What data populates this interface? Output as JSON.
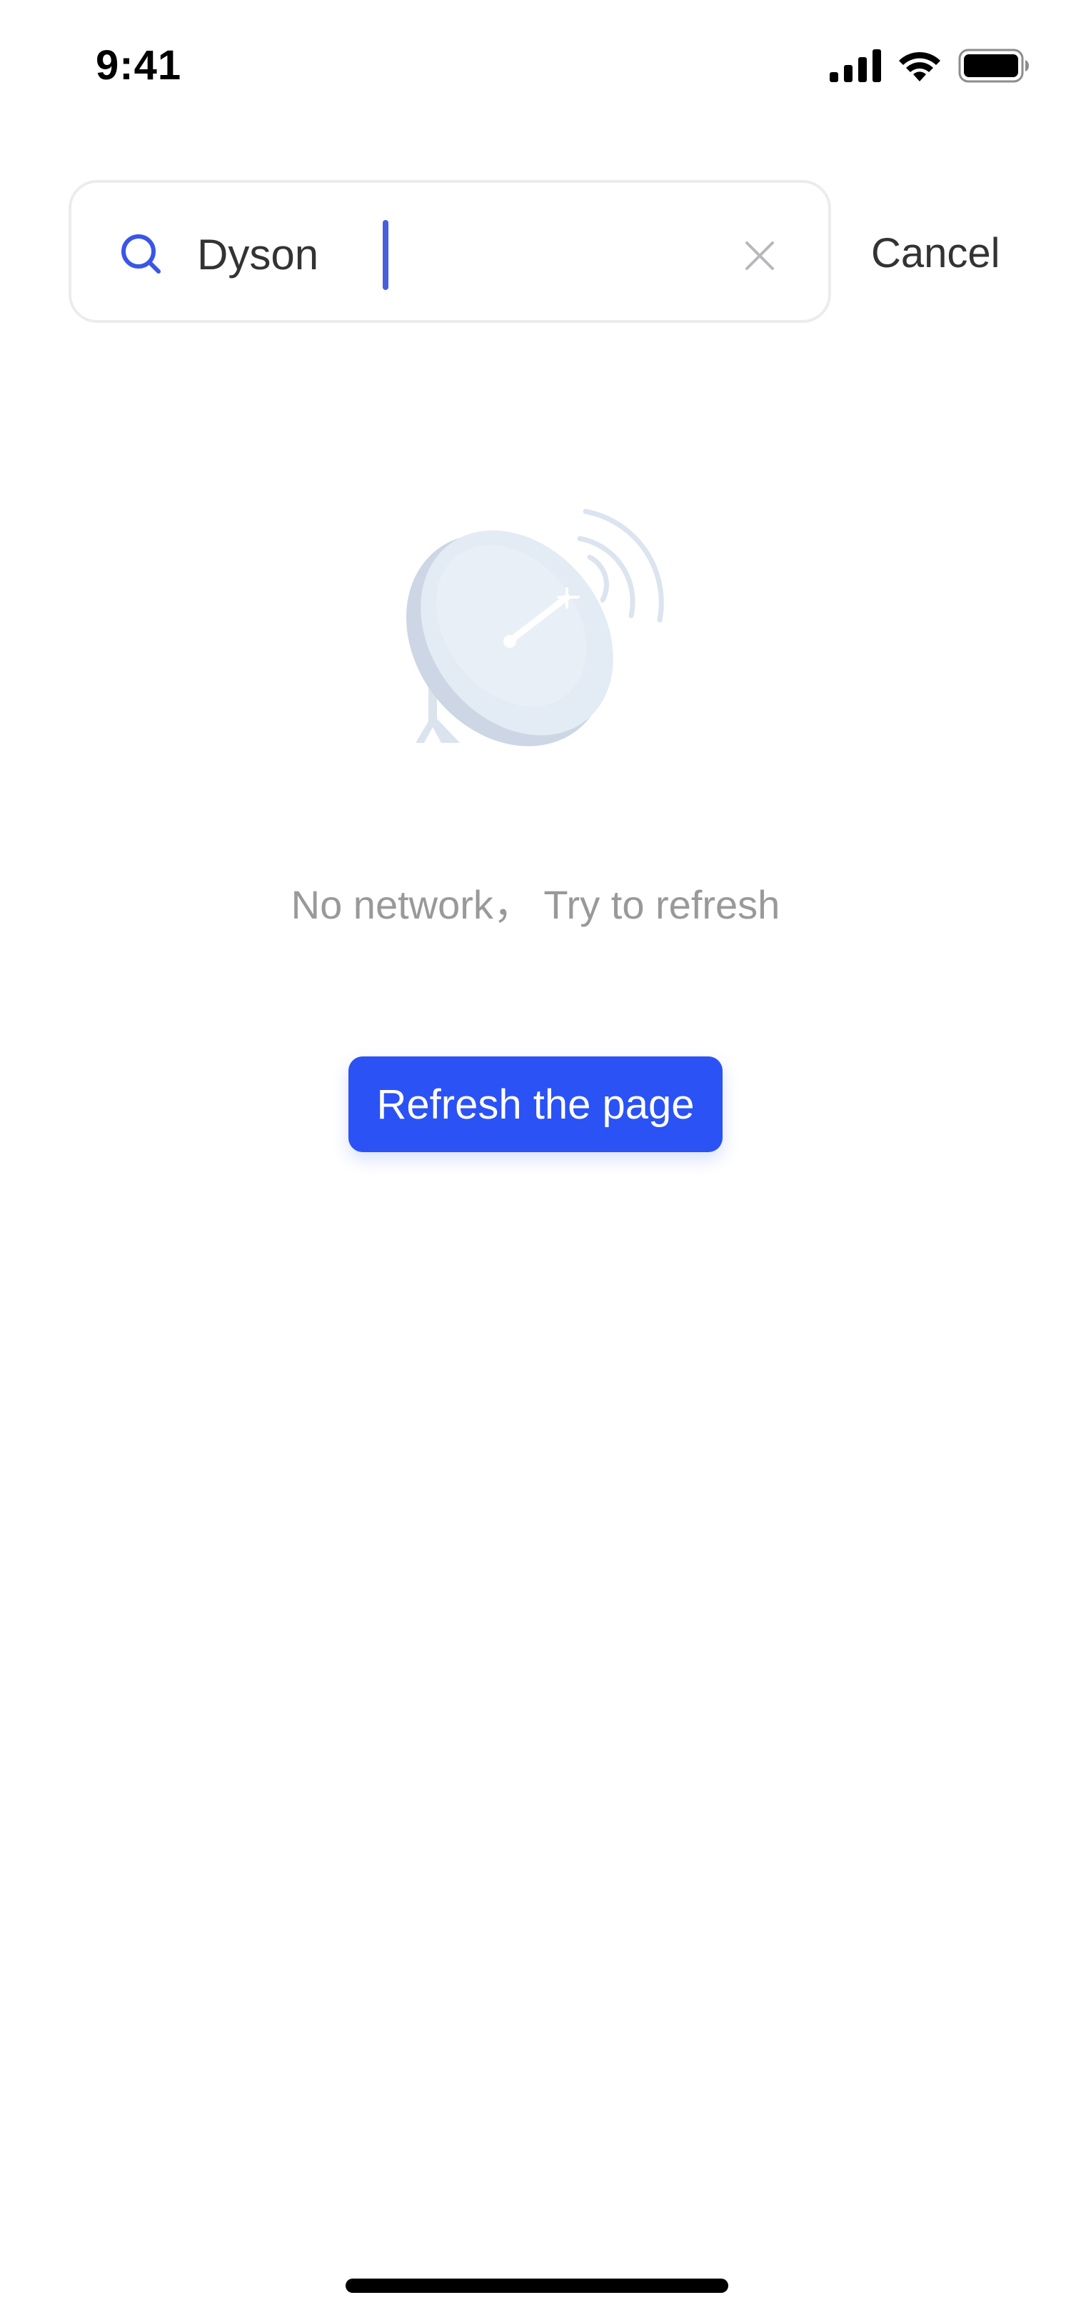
{
  "status_bar": {
    "time": "9:41",
    "icons": [
      "signal-icon",
      "wifi-icon",
      "battery-icon"
    ]
  },
  "search": {
    "value": "Dyson",
    "placeholder": "",
    "cancel_label": "Cancel"
  },
  "empty_state": {
    "illustration": "satellite-dish-illustration",
    "message": "No network， Try to refresh",
    "button_label": "Refresh the page"
  },
  "colors": {
    "accent": "#2a52f5",
    "search_icon": "#3a56e8",
    "caret": "#4a5fdc",
    "message_text": "#999999",
    "primary_text": "#333333",
    "input_border": "#ececee",
    "illustration_fill": "#e3ebf4"
  }
}
